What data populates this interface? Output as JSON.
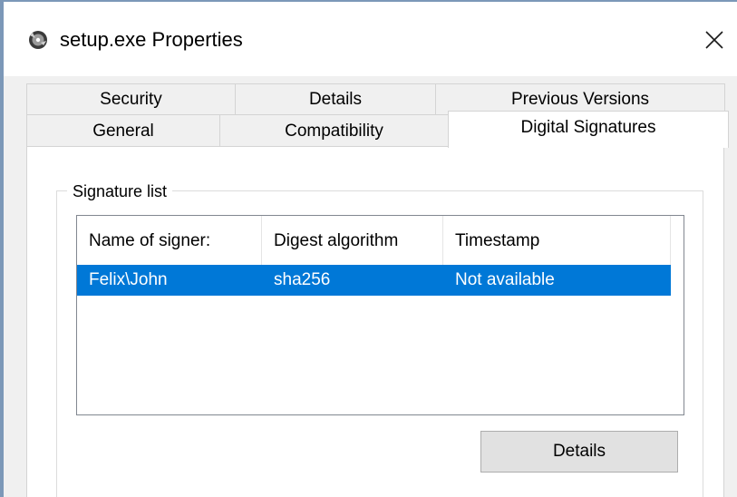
{
  "window": {
    "title": "setup.exe Properties",
    "icon": "disc-setup-icon",
    "close_glyph": "✕"
  },
  "tabs": {
    "row1": [
      {
        "label": "Security"
      },
      {
        "label": "Details"
      },
      {
        "label": "Previous Versions"
      }
    ],
    "row2": [
      {
        "label": "General"
      },
      {
        "label": "Compatibility"
      },
      {
        "label": "Digital Signatures",
        "selected": true
      }
    ]
  },
  "signature_list": {
    "legend": "Signature list",
    "columns": [
      "Name of signer:",
      "Digest algorithm",
      "Timestamp"
    ],
    "rows": [
      {
        "signer": "Felix\\John",
        "digest": "sha256",
        "timestamp": "Not available",
        "selected": true
      }
    ],
    "details_button": "Details"
  },
  "colors": {
    "selection": "#0078d7",
    "window_border": "#7c98b8",
    "panel_bg": "#ffffff",
    "chrome_bg": "#f0f0f0"
  }
}
